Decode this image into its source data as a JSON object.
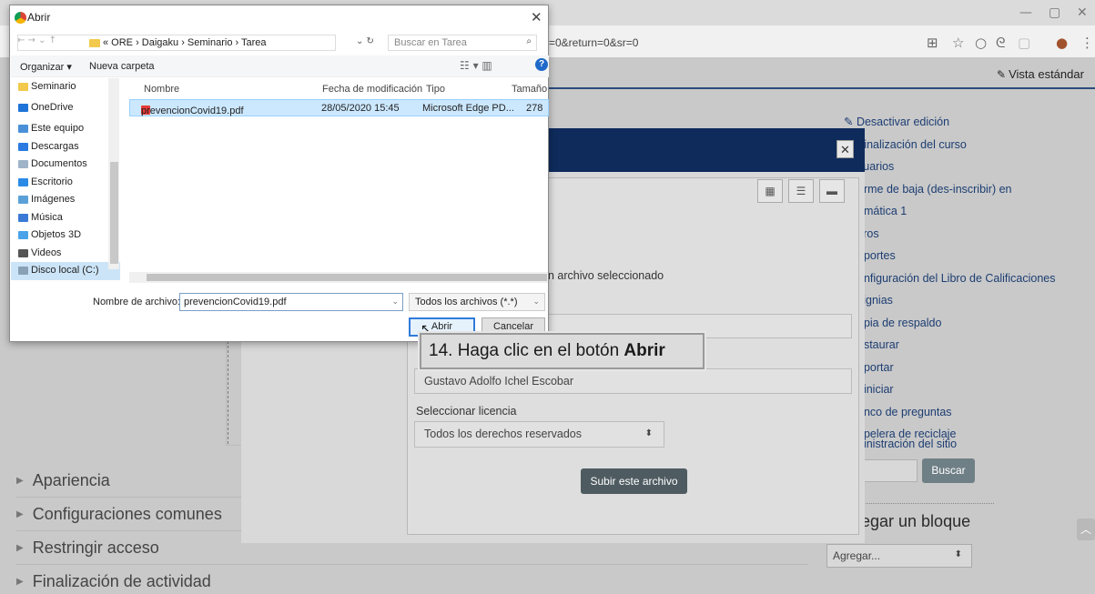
{
  "browser": {
    "url_fragment": "=0&return=0&sr=0",
    "window_controls": [
      "—",
      "▢",
      "✕"
    ],
    "ext_icons": [
      "grid-icon",
      "star-icon",
      "circle-icon",
      "swirl-icon",
      "box-icon",
      "avatar-icon",
      "menu-icon"
    ]
  },
  "page": {
    "vista_label": "Vista estándar",
    "right_menu": [
      "Desactivar edición",
      "Finalización del curso",
      "suarios",
      "arme de baja (des-inscribir) en",
      "emática 1",
      "ltros",
      "eportes",
      "onfiguración del Libro de Calificaciones",
      "signias",
      "opia de respaldo",
      "estaurar",
      "nportar",
      "einiciar",
      "anco de preguntas",
      "apelera de reciclaje"
    ],
    "admin_label": "ninistración del sitio",
    "search_button": "Buscar",
    "add_block_title": "regar un bloque",
    "add_block_select": "Agregar...",
    "sections": [
      "Apariencia",
      "Configuraciones comunes",
      "Restringir acceso",
      "Finalización de actividad"
    ]
  },
  "picker": {
    "no_file": "ún archivo seleccionado",
    "author": "Gustavo Adolfo Ichel Escobar",
    "license_label": "Seleccionar licencia",
    "license_value": "Todos los derechos reservados",
    "upload_button": "Subir este archivo"
  },
  "dialog": {
    "title": "Abrir",
    "breadcrumb": "« ORE › Daigaku › Seminario › Tarea",
    "search_placeholder": "Buscar en Tarea",
    "organize": "Organizar ▾",
    "new_folder": "Nueva carpeta",
    "nav_items": [
      {
        "label": "Seminario",
        "color": "#f2c94c",
        "selected": false
      },
      {
        "label": "OneDrive",
        "color": "#1e73d8",
        "selected": false
      },
      {
        "label": "Este equipo",
        "color": "#4a90d9",
        "selected": false
      },
      {
        "label": "Descargas",
        "color": "#2a7ae2",
        "selected": false
      },
      {
        "label": "Documentos",
        "color": "#9fb4c8",
        "selected": false
      },
      {
        "label": "Escritorio",
        "color": "#2b8ae6",
        "selected": false
      },
      {
        "label": "Imágenes",
        "color": "#5aa0d8",
        "selected": false
      },
      {
        "label": "Música",
        "color": "#3a7ad6",
        "selected": false
      },
      {
        "label": "Objetos 3D",
        "color": "#4aa3e8",
        "selected": false
      },
      {
        "label": "Videos",
        "color": "#555555",
        "selected": false
      },
      {
        "label": "Disco local (C:)",
        "color": "#8aa0b6",
        "selected": true
      }
    ],
    "columns": [
      "Nombre",
      "Fecha de modificación",
      "Tipo",
      "Tamaño"
    ],
    "file": {
      "name": "prevencionCovid19.pdf",
      "date": "28/05/2020 15:45",
      "type": "Microsoft Edge PD...",
      "size": "278"
    },
    "filename_label": "Nombre de archivo:",
    "filename_value": "prevencionCovid19.pdf",
    "filetype_value": "Todos los archivos (*.*)",
    "open_button": "Abrir",
    "cancel_button": "Cancelar"
  },
  "callout": {
    "prefix": "14. Haga clic en el botón ",
    "bold": "Abrir"
  }
}
